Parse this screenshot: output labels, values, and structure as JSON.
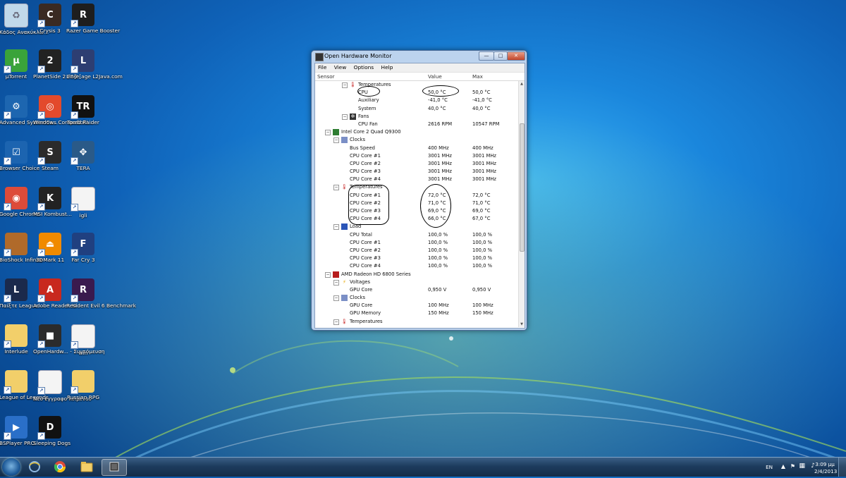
{
  "desktop": {
    "icons": [
      {
        "label": "Κάδος Ανακύκλω...",
        "color": "#c0d8ea"
      },
      {
        "label": "Crysis 3",
        "color": "#3a2a22"
      },
      {
        "label": "Razer Game Booster",
        "color": "#1e1e1e"
      },
      {
        "label": "µTorrent",
        "color": "#3aa33a"
      },
      {
        "label": "PlanetSide 2 PSG",
        "color": "#222222"
      },
      {
        "label": "Lin]e[age L2Java.com",
        "color": "#2d3e72"
      },
      {
        "label": "Advanced SystemCa...",
        "color": "#1d66b0"
      },
      {
        "label": "Windows Compatibili...",
        "color": "#e34a2c"
      },
      {
        "label": "Tomb Raider",
        "color": "#111111"
      },
      {
        "label": "Browser Choice",
        "color": "#1c64b0"
      },
      {
        "label": "Steam",
        "color": "#2b2b2b"
      },
      {
        "label": "TERA",
        "color": "#2a5a88"
      },
      {
        "label": "Google Chrome",
        "color": "#dd4b39"
      },
      {
        "label": "MSI Kombust...",
        "color": "#222222"
      },
      {
        "label": "igli",
        "color": "#f4f4f4"
      },
      {
        "label": "BioShock Infinite",
        "color": "#b06a2a"
      },
      {
        "label": "3DMark 11",
        "color": "#f08a00"
      },
      {
        "label": "Far Cry 3",
        "color": "#204080"
      },
      {
        "label": "Παίξτε League ...",
        "color": "#1b2a4c"
      },
      {
        "label": "Adobe Reader XI",
        "color": "#c8281e"
      },
      {
        "label": "Resident Evil 6 Benchmark",
        "color": "#3a1a4e"
      },
      {
        "label": "Interlude",
        "color": "#f2cf6a"
      },
      {
        "label": "OpenHardw... - Συντόμευση",
        "color": "#2b2b2b"
      },
      {
        "label": "win",
        "color": "#f4f4f4"
      },
      {
        "label": "League of Legends",
        "color": "#f2cf6a"
      },
      {
        "label": "Νέο έγγραφο κειμένου",
        "color": "#f4f4f4"
      },
      {
        "label": "Russian RPG",
        "color": "#f2cf6a"
      },
      {
        "label": "BSPlayer PRO",
        "color": "#2a6fc8"
      },
      {
        "label": "Sleeping Dogs",
        "color": "#111111"
      }
    ]
  },
  "window": {
    "title": "Open Hardware Monitor",
    "controls": {
      "minimize": "—",
      "maximize": "□",
      "close": "✕"
    },
    "menu": [
      "File",
      "View",
      "Options",
      "Help"
    ],
    "columns": {
      "sensor": "Sensor",
      "value": "Value",
      "max": "Max"
    },
    "rows": [
      {
        "level": 3,
        "toggle": "⊟",
        "icon": "thermometer",
        "name": "Temperatures",
        "value": "",
        "max": ""
      },
      {
        "level": 4,
        "toggle": "",
        "icon": "",
        "name": "CPU",
        "value": "50,0 °C",
        "max": "50,0 °C"
      },
      {
        "level": 4,
        "toggle": "",
        "icon": "",
        "name": "Auxiliary",
        "value": "-41,0 °C",
        "max": "-41,0 °C"
      },
      {
        "level": 4,
        "toggle": "",
        "icon": "",
        "name": "System",
        "value": "40,0 °C",
        "max": "40,0 °C"
      },
      {
        "level": 3,
        "toggle": "⊟",
        "icon": "fan",
        "name": "Fans",
        "value": "",
        "max": ""
      },
      {
        "level": 4,
        "toggle": "",
        "icon": "",
        "name": "CPU Fan",
        "value": "2616 RPM",
        "max": "10547 RPM"
      },
      {
        "level": 1,
        "toggle": "⊟",
        "icon": "chip",
        "name": "Intel Core 2 Quad Q9300",
        "value": "",
        "max": ""
      },
      {
        "level": 2,
        "toggle": "⊟",
        "icon": "clock",
        "name": "Clocks",
        "value": "",
        "max": ""
      },
      {
        "level": 3,
        "toggle": "",
        "icon": "",
        "name": "Bus Speed",
        "value": "400 MHz",
        "max": "400 MHz"
      },
      {
        "level": 3,
        "toggle": "",
        "icon": "",
        "name": "CPU Core #1",
        "value": "3001 MHz",
        "max": "3001 MHz"
      },
      {
        "level": 3,
        "toggle": "",
        "icon": "",
        "name": "CPU Core #2",
        "value": "3001 MHz",
        "max": "3001 MHz"
      },
      {
        "level": 3,
        "toggle": "",
        "icon": "",
        "name": "CPU Core #3",
        "value": "3001 MHz",
        "max": "3001 MHz"
      },
      {
        "level": 3,
        "toggle": "",
        "icon": "",
        "name": "CPU Core #4",
        "value": "3001 MHz",
        "max": "3001 MHz"
      },
      {
        "level": 2,
        "toggle": "⊟",
        "icon": "thermometer",
        "name": "Temperatures",
        "value": "",
        "max": ""
      },
      {
        "level": 3,
        "toggle": "",
        "icon": "",
        "name": "CPU Core #1",
        "value": "72,0 °C",
        "max": "72,0 °C"
      },
      {
        "level": 3,
        "toggle": "",
        "icon": "",
        "name": "CPU Core #2",
        "value": "71,0 °C",
        "max": "71,0 °C"
      },
      {
        "level": 3,
        "toggle": "",
        "icon": "",
        "name": "CPU Core #3",
        "value": "69,0 °C",
        "max": "69,0 °C"
      },
      {
        "level": 3,
        "toggle": "",
        "icon": "",
        "name": "CPU Core #4",
        "value": "66,0 °C",
        "max": "67,0 °C"
      },
      {
        "level": 2,
        "toggle": "⊟",
        "icon": "load",
        "name": "Load",
        "value": "",
        "max": ""
      },
      {
        "level": 3,
        "toggle": "",
        "icon": "",
        "name": "CPU Total",
        "value": "100,0 %",
        "max": "100,0 %"
      },
      {
        "level": 3,
        "toggle": "",
        "icon": "",
        "name": "CPU Core #1",
        "value": "100,0 %",
        "max": "100,0 %"
      },
      {
        "level": 3,
        "toggle": "",
        "icon": "",
        "name": "CPU Core #2",
        "value": "100,0 %",
        "max": "100,0 %"
      },
      {
        "level": 3,
        "toggle": "",
        "icon": "",
        "name": "CPU Core #3",
        "value": "100,0 %",
        "max": "100,0 %"
      },
      {
        "level": 3,
        "toggle": "",
        "icon": "",
        "name": "CPU Core #4",
        "value": "100,0 %",
        "max": "100,0 %"
      },
      {
        "level": 1,
        "toggle": "⊟",
        "icon": "gpu",
        "name": "AMD Radeon HD 6800 Series",
        "value": "",
        "max": ""
      },
      {
        "level": 2,
        "toggle": "⊟",
        "icon": "voltage",
        "name": "Voltages",
        "value": "",
        "max": ""
      },
      {
        "level": 3,
        "toggle": "",
        "icon": "",
        "name": "GPU Core",
        "value": "0,950 V",
        "max": "0,950 V"
      },
      {
        "level": 2,
        "toggle": "⊟",
        "icon": "clock",
        "name": "Clocks",
        "value": "",
        "max": ""
      },
      {
        "level": 3,
        "toggle": "",
        "icon": "",
        "name": "GPU Core",
        "value": "100 MHz",
        "max": "100 MHz"
      },
      {
        "level": 3,
        "toggle": "",
        "icon": "",
        "name": "GPU Memory",
        "value": "150 MHz",
        "max": "150 MHz"
      },
      {
        "level": 2,
        "toggle": "⊟",
        "icon": "thermometer",
        "name": "Temperatures",
        "value": "",
        "max": ""
      }
    ]
  },
  "taskbar": {
    "pinned": [
      "start-orb",
      "ie-icon",
      "chrome-icon",
      "explorer-icon",
      "openhardwaremonitor-icon"
    ],
    "language": "EN",
    "time": "3:09 μμ",
    "date": "2/4/2013"
  }
}
